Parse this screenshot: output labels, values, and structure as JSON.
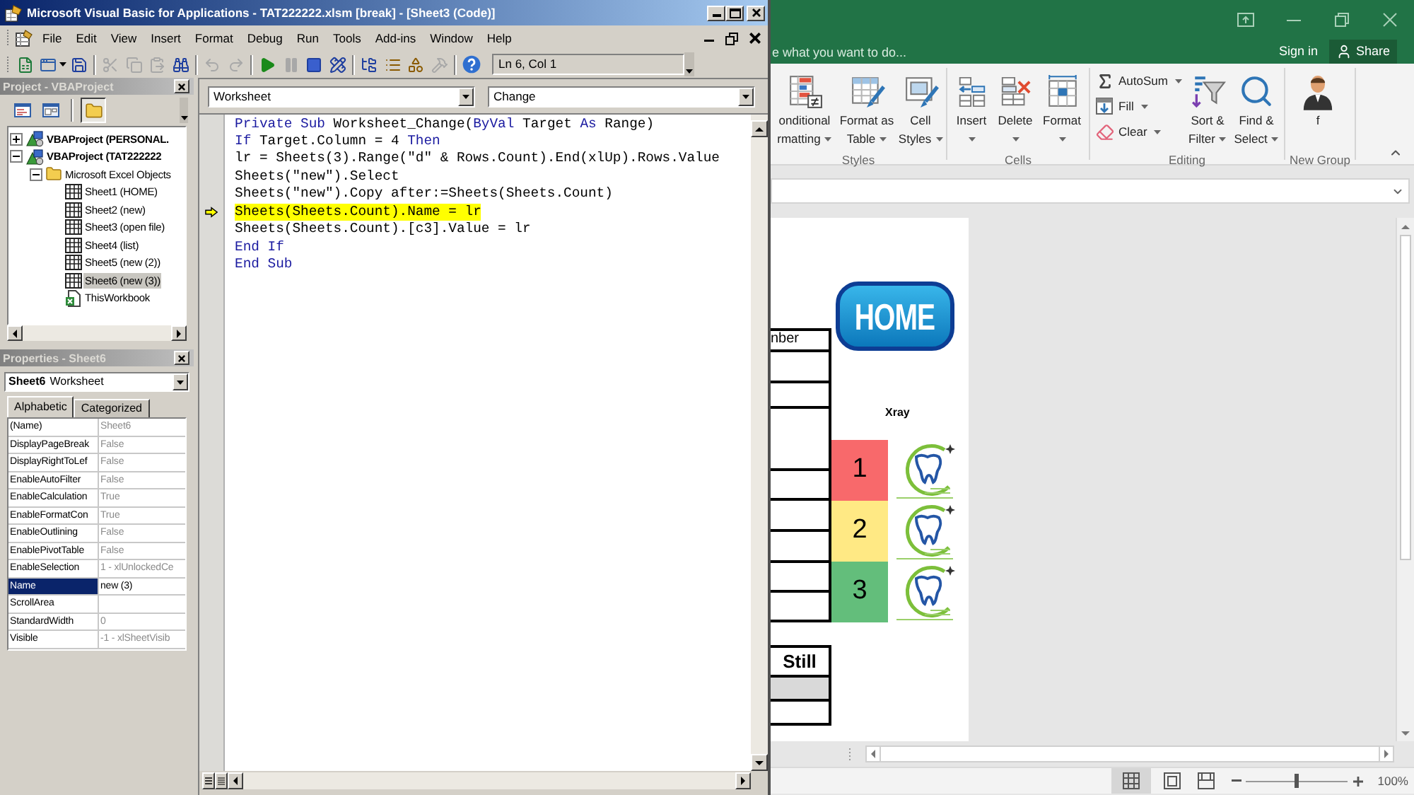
{
  "vba_window": {
    "title": "Microsoft Visual Basic for Applications - TAT222222.xlsm [break] - [Sheet3 (Code)]",
    "menu": [
      "File",
      "Edit",
      "View",
      "Insert",
      "Format",
      "Debug",
      "Run",
      "Tools",
      "Add-ins",
      "Window",
      "Help"
    ],
    "toolbar": [
      {
        "kind": "excel",
        "disabled": false
      },
      {
        "kind": "insert-form",
        "disabled": false
      },
      {
        "kind": "save",
        "disabled": false
      },
      {
        "kind": "separator"
      },
      {
        "kind": "cut",
        "disabled": true
      },
      {
        "kind": "copy",
        "disabled": true
      },
      {
        "kind": "paste",
        "disabled": true
      },
      {
        "kind": "find",
        "disabled": false
      },
      {
        "kind": "separator"
      },
      {
        "kind": "undo",
        "disabled": true
      },
      {
        "kind": "redo",
        "disabled": true
      },
      {
        "kind": "separator"
      },
      {
        "kind": "run",
        "disabled": false
      },
      {
        "kind": "pause",
        "disabled": true
      },
      {
        "kind": "stop",
        "disabled": false
      },
      {
        "kind": "design",
        "disabled": false
      },
      {
        "kind": "separator"
      },
      {
        "kind": "project",
        "disabled": false
      },
      {
        "kind": "properties",
        "disabled": false
      },
      {
        "kind": "object-browser",
        "disabled": false
      },
      {
        "kind": "toolbox",
        "disabled": true
      },
      {
        "kind": "separator"
      },
      {
        "kind": "help",
        "disabled": false
      }
    ],
    "cursor_position": "Ln 6, Col 1",
    "project": {
      "title": "Project - VBAProject",
      "toolbar": [
        {
          "kind": "view-code",
          "pressed": false
        },
        {
          "kind": "view-object",
          "pressed": false
        },
        {
          "kind": "separator"
        },
        {
          "kind": "toggle-folders",
          "pressed": true
        }
      ],
      "tree": [
        {
          "label": "VBAProject (PERSONAL.",
          "kind": "project",
          "expanded": false,
          "selected": false
        },
        {
          "label": "VBAProject (TAT222222",
          "kind": "project",
          "expanded": true,
          "selected": false,
          "children": [
            {
              "label": "Microsoft Excel Objects",
              "kind": "folder",
              "expanded": true,
              "selected": false,
              "children": [
                {
                  "label": "Sheet1 (HOME)",
                  "kind": "sheet",
                  "selected": false
                },
                {
                  "label": "Sheet2 (new)",
                  "kind": "sheet",
                  "selected": false
                },
                {
                  "label": "Sheet3 (open file)",
                  "kind": "sheet",
                  "selected": false
                },
                {
                  "label": "Sheet4 (list)",
                  "kind": "sheet",
                  "selected": false
                },
                {
                  "label": "Sheet5 (new (2))",
                  "kind": "sheet",
                  "selected": false
                },
                {
                  "label": "Sheet6 (new (3))",
                  "kind": "sheet",
                  "selected": true
                },
                {
                  "label": "ThisWorkbook",
                  "kind": "workbook",
                  "selected": false
                }
              ]
            }
          ]
        }
      ]
    },
    "properties": {
      "title": "Properties - Sheet6",
      "object": {
        "name": "Sheet6",
        "type": "Worksheet"
      },
      "tabs": [
        {
          "label": "Alphabetic",
          "selected": true
        },
        {
          "label": "Categorized",
          "selected": false
        }
      ],
      "rows": [
        {
          "name": "(Name)",
          "value": "Sheet6",
          "selected": false
        },
        {
          "name": "DisplayPageBreak",
          "value": "False",
          "selected": false
        },
        {
          "name": "DisplayRightToLef",
          "value": "False",
          "selected": false
        },
        {
          "name": "EnableAutoFilter",
          "value": "False",
          "selected": false
        },
        {
          "name": "EnableCalculation",
          "value": "True",
          "selected": false
        },
        {
          "name": "EnableFormatCon",
          "value": "True",
          "selected": false
        },
        {
          "name": "EnableOutlining",
          "value": "False",
          "selected": false
        },
        {
          "name": "EnablePivotTable",
          "value": "False",
          "selected": false
        },
        {
          "name": "EnableSelection",
          "value": "1 - xlUnlockedCe",
          "selected": false
        },
        {
          "name": "Name",
          "value": "new (3)",
          "selected": true
        },
        {
          "name": "ScrollArea",
          "selected": false
        },
        {
          "name": "StandardWidth",
          "value": "0",
          "selected": false
        },
        {
          "name": "Visible",
          "value": "-1 - xlSheetVisib",
          "selected": false
        }
      ]
    },
    "code": {
      "object": "Worksheet",
      "procedure": "Change",
      "lines": [
        {
          "current": false,
          "tokens": [
            {
              "text": "Private Sub",
              "kind": "keyword"
            },
            {
              "text": " Worksheet_Change(",
              "kind": "plain"
            },
            {
              "text": "ByVal",
              "kind": "keyword"
            },
            {
              "text": " Target ",
              "kind": "plain"
            },
            {
              "text": "As",
              "kind": "keyword"
            },
            {
              "text": " Range)",
              "kind": "plain"
            }
          ]
        },
        {
          "current": false,
          "tokens": [
            {
              "text": "If",
              "kind": "keyword"
            },
            {
              "text": " Target.Column = 4 ",
              "kind": "plain"
            },
            {
              "text": "Then",
              "kind": "keyword"
            }
          ]
        },
        {
          "current": false,
          "tokens": [
            {
              "text": "lr = Sheets(3).Range(\"d\" & Rows.Count).End(xlUp).Rows.Value",
              "kind": "plain"
            }
          ]
        },
        {
          "current": false,
          "tokens": [
            {
              "text": "Sheets(\"new\").Select",
              "kind": "plain"
            }
          ]
        },
        {
          "current": false,
          "tokens": [
            {
              "text": "Sheets(\"new\").Copy after:=Sheets(Sheets.Count)",
              "kind": "plain"
            }
          ]
        },
        {
          "current": true,
          "tokens": [
            {
              "text": "Sheets(Sheets.Count).Name = lr",
              "kind": "plain"
            }
          ]
        },
        {
          "current": false,
          "tokens": [
            {
              "text": "Sheets(Sheets.Count).[c3].Value = lr",
              "kind": "plain"
            }
          ]
        },
        {
          "current": false,
          "tokens": [
            {
              "text": "End If",
              "kind": "keyword"
            }
          ]
        },
        {
          "current": false,
          "tokens": [
            {
              "text": "End Sub",
              "kind": "keyword"
            }
          ]
        }
      ]
    }
  },
  "excel_window": {
    "tell_me": {
      "placeholder": "e what you want to do..."
    },
    "sign_in": "Sign in",
    "share": "Share",
    "ribbon": [
      {
        "label": "Styles",
        "items": [
          {
            "kind": "conditional-formatting",
            "lines": [
              "onditional",
              "rmatting"
            ],
            "dropdown": true
          },
          {
            "kind": "format-as-table",
            "lines": [
              "Format as",
              "Table"
            ],
            "dropdown": true
          },
          {
            "kind": "cell-styles",
            "lines": [
              "Cell",
              "Styles"
            ],
            "dropdown": true
          }
        ]
      },
      {
        "label": "Cells",
        "items": [
          {
            "kind": "insert-cells",
            "lines": [
              "Insert"
            ],
            "dropdown": true
          },
          {
            "kind": "delete-cells",
            "lines": [
              "Delete"
            ],
            "dropdown": true
          },
          {
            "kind": "format-cells",
            "lines": [
              "Format"
            ],
            "dropdown": true
          }
        ]
      },
      {
        "label": "Editing",
        "items": [
          {
            "kind": "stack",
            "buttons": [
              {
                "kind": "autosum",
                "label": "AutoSum",
                "dropdown": true
              },
              {
                "kind": "fill",
                "label": "Fill",
                "dropdown": true
              },
              {
                "kind": "clear",
                "label": "Clear",
                "dropdown": true
              }
            ]
          },
          {
            "kind": "sort-filter",
            "lines": [
              "Sort &",
              "Filter"
            ],
            "dropdown": true
          },
          {
            "kind": "find-select",
            "lines": [
              "Find &",
              "Select"
            ],
            "dropdown": true
          }
        ]
      },
      {
        "label": "New Group",
        "items": [
          {
            "kind": "user",
            "lines": [
              "f"
            ],
            "dropdown": false
          }
        ]
      }
    ],
    "sheet": {
      "header": "nber",
      "home_button": "HOME",
      "xray_label": "Xray",
      "levels": [
        {
          "label": "1",
          "color": "#f8696b"
        },
        {
          "label": "2",
          "color": "#ffe984"
        },
        {
          "label": "3",
          "color": "#63be7b"
        }
      ],
      "still_header": "Still"
    },
    "status_bar": {
      "views": [
        {
          "kind": "normal",
          "selected": true
        },
        {
          "kind": "page-layout",
          "selected": false
        },
        {
          "kind": "page-break",
          "selected": false
        }
      ],
      "zoom": {
        "level": 0.5,
        "reading": "100%"
      }
    }
  }
}
